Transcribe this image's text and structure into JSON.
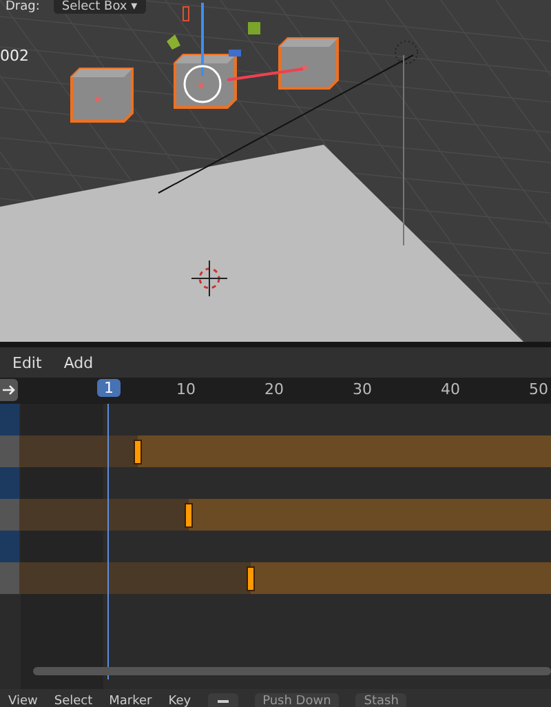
{
  "viewport": {
    "header": {
      "label": "Drag:",
      "tool": "Select Box",
      "caret": "▾"
    },
    "object_label": "002"
  },
  "menu": [
    "Edit",
    "Add"
  ],
  "ruler": {
    "current_frame": "1",
    "ticks": [
      "10",
      "20",
      "30",
      "40",
      "50"
    ]
  },
  "tracks": [
    {
      "kind": "channel"
    },
    {
      "kind": "strip",
      "level": 0.223
    },
    {
      "kind": "channel"
    },
    {
      "kind": "strip",
      "level": 0.319
    },
    {
      "kind": "channel"
    },
    {
      "kind": "strip",
      "level": 0.436
    }
  ],
  "footer": {
    "menus": [
      "View",
      "Select",
      "Marker",
      "Key"
    ],
    "actions": [
      "Push Down",
      "Stash"
    ]
  }
}
